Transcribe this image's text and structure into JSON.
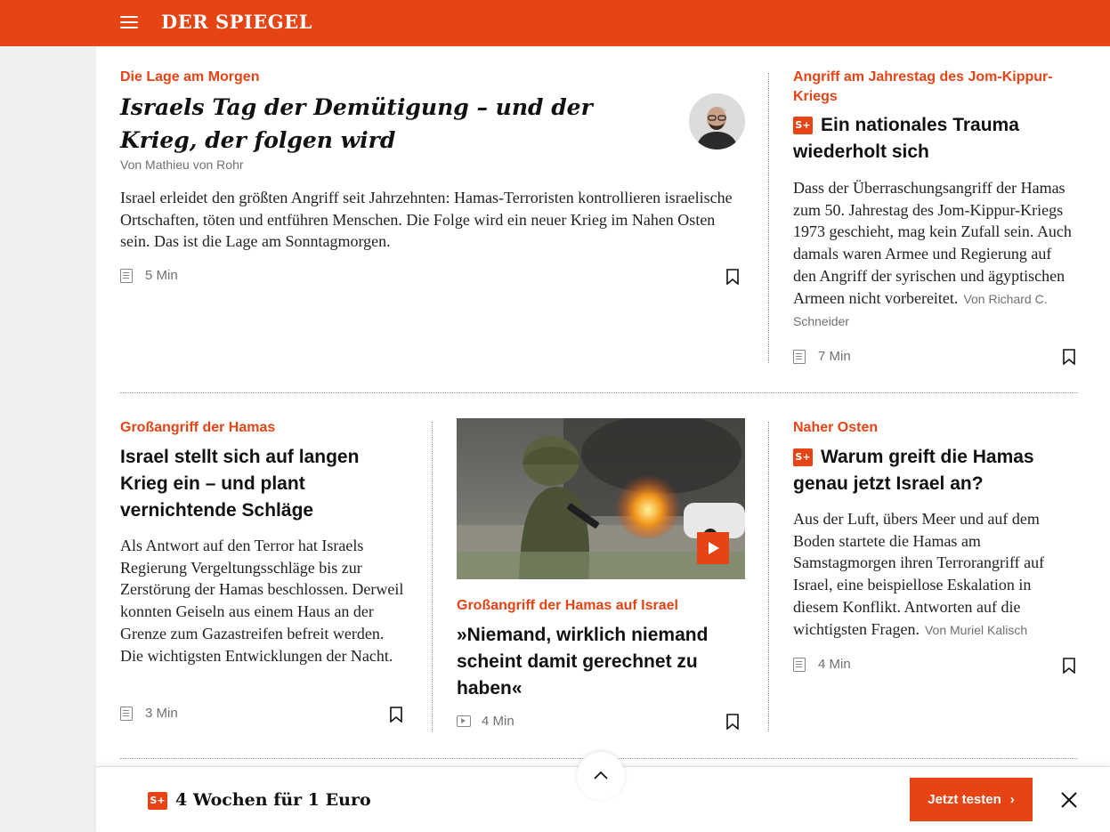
{
  "brand": {
    "logo": "DER SPIEGEL",
    "color": "#e64415"
  },
  "articles": [
    {
      "kicker": "Die Lage am Morgen",
      "headline": "Israels Tag der Demütigung – und der Krieg, der folgen wird",
      "byline": "Von Mathieu von Rohr",
      "teaser": "Israel erleidet den größten Angriff seit Jahrzehnten: Hamas-Terroristen kontrollieren israelische Ortschaften, töten und entführen Menschen. Die Folge wird ein neuer Krieg im Nahen Osten sein. Das ist die Lage am Sonntagmorgen.",
      "read_time": "5 Min"
    },
    {
      "kicker": "Angriff am Jahrestag des Jom-Kippur-Kriegs",
      "badge": "S+",
      "headline": "Ein nationales Trauma wiederholt sich",
      "teaser": "Dass der Überraschungsangriff der Hamas zum 50. Jahrestag des Jom-Kippur-Kriegs 1973 geschieht, mag kein Zufall sein. Auch damals waren Armee und Regierung auf den Angriff der syrischen und ägyptischen Armeen nicht vorbereitet.",
      "byline": "Von Richard C. Schneider",
      "read_time": "7 Min"
    },
    {
      "kicker": "Großangriff der Hamas",
      "headline": "Israel stellt sich auf langen Krieg ein – und plant vernichtende Schläge",
      "teaser": "Als Antwort auf den Terror hat Israels Regierung Vergeltungsschläge bis zur Zerstörung der Hamas beschlossen. Derweil konnten Geiseln aus einem Haus an der Grenze zum Gazastreifen befreit werden. Die wichtigsten Entwicklungen der Nacht.",
      "read_time": "3 Min"
    },
    {
      "kicker": "Großangriff der Hamas auf Israel",
      "headline": "»Niemand, wirklich niemand scheint damit gerechnet zu haben«",
      "read_time": "4 Min"
    },
    {
      "kicker": "Naher Osten",
      "badge": "S+",
      "headline": "Warum greift die Hamas genau jetzt Israel an?",
      "teaser": "Aus der Luft, übers Meer und auf dem Boden startete die Hamas am Samstagmorgen ihren Terrorangriff auf Israel, eine beispiellose Eskalation in diesem Konflikt. Antworten auf die wichtigsten Fragen.",
      "byline": "Von Muriel Kalisch",
      "read_time": "4 Min"
    }
  ],
  "promo": {
    "badge": "S+",
    "text": "4 Wochen für 1 Euro",
    "cta_label": "Jetzt testen",
    "cta_chevron": "›"
  }
}
